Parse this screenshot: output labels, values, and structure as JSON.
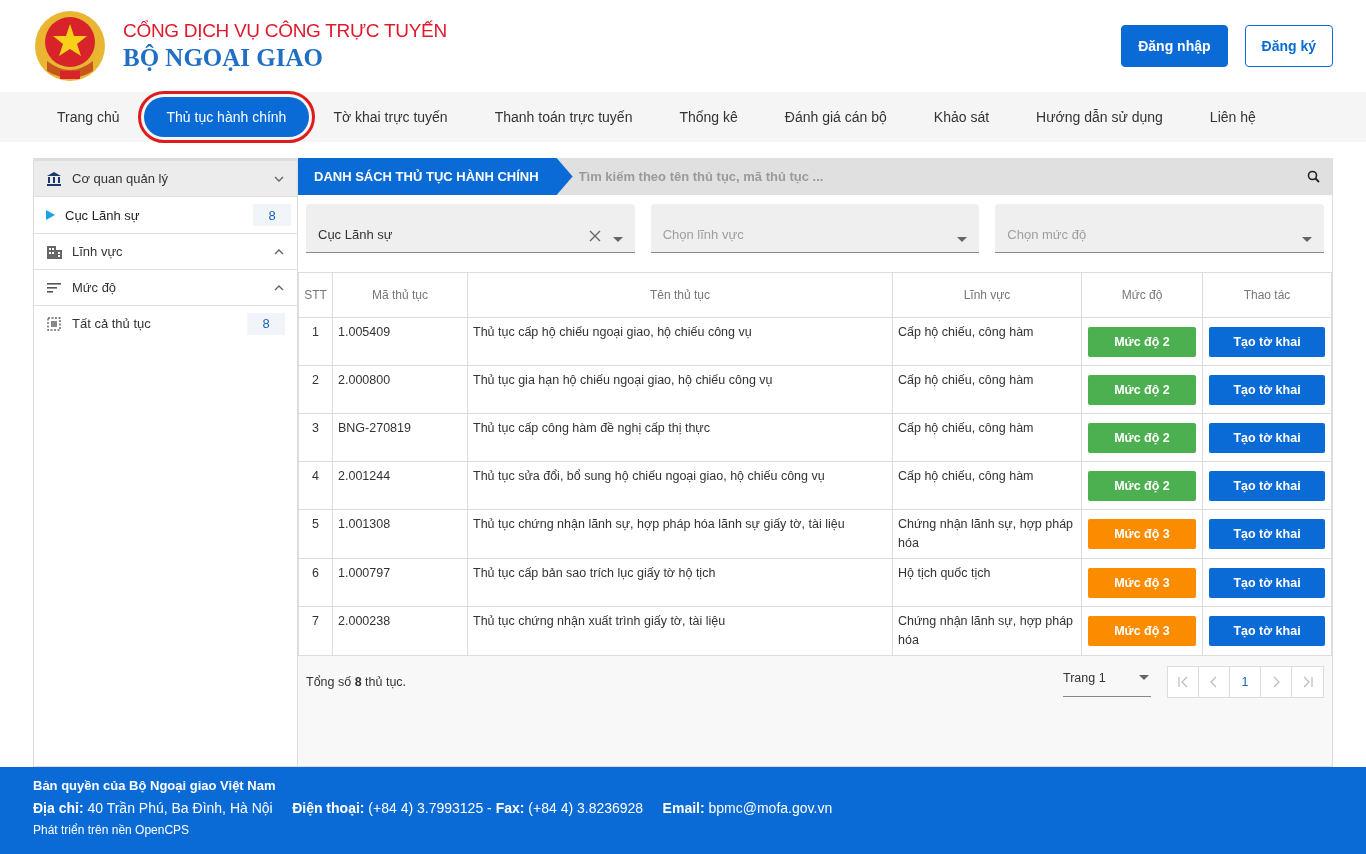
{
  "header": {
    "title_top": "CỔNG DỊCH VỤ CÔNG TRỰC TUYẾN",
    "title_main": "BỘ NGOẠI GIAO",
    "buttons": [
      {
        "label": "Đăng nhập",
        "kind": "primary"
      },
      {
        "label": "Đăng ký",
        "kind": "outline"
      }
    ]
  },
  "nav": {
    "tabs": [
      {
        "label": "Trang chủ",
        "selected": false
      },
      {
        "label": "Thủ tục hành chính",
        "selected": true
      },
      {
        "label": "Tờ khai trực tuyến",
        "selected": false
      },
      {
        "label": "Thanh toán trực tuyến",
        "selected": false
      },
      {
        "label": "Thống kê",
        "selected": false
      },
      {
        "label": "Đánh giá cán bộ",
        "selected": false
      },
      {
        "label": "Khảo sát",
        "selected": false
      },
      {
        "label": "Hướng dẫn sử dụng",
        "selected": false
      },
      {
        "label": "Liên hệ",
        "selected": false
      }
    ]
  },
  "sidebar": {
    "sections": [
      {
        "kind": "agency",
        "label": "Cơ quan quản lý",
        "expanded": true,
        "children": [
          {
            "label": "Cục Lãnh sự",
            "count": "8",
            "selected": true
          }
        ]
      },
      {
        "kind": "field",
        "label": "Lĩnh vực",
        "expanded": false
      },
      {
        "kind": "level",
        "label": "Mức độ",
        "expanded": false
      },
      {
        "kind": "all",
        "label": "Tất cả thủ tục",
        "count": "8"
      }
    ]
  },
  "list": {
    "title": "DANH SÁCH THỦ TỤC HÀNH CHÍNH",
    "search": {
      "placeholder": "Tìm kiếm theo tên thủ tục, mã thủ tục ..."
    },
    "filters": [
      {
        "value": "Cục Lãnh sự",
        "clearable": true
      },
      {
        "placeholder": "Chọn lĩnh vực",
        "clearable": false
      },
      {
        "placeholder": "Chọn mức độ",
        "clearable": false
      }
    ],
    "table": {
      "columns": [
        "STT",
        "Mã thủ tục",
        "Tên thủ tục",
        "Lĩnh vực",
        "Mức độ",
        "Thao tác"
      ],
      "rows": [
        {
          "stt": "1",
          "code": "1.005409",
          "name": "Thủ tục cấp hộ chiếu ngoại giao, hộ chiếu công vụ",
          "field": "Cấp hộ chiếu, công hàm",
          "level": {
            "label": "Mức độ 2",
            "color": "#4caf50"
          },
          "action": "Tạo tờ khai"
        },
        {
          "stt": "2",
          "code": "2.000800",
          "name": "Thủ tục gia hạn hộ chiếu ngoại giao, hộ chiếu công vụ",
          "field": "Cấp hộ chiếu, công hàm",
          "level": {
            "label": "Mức độ 2",
            "color": "#4caf50"
          },
          "action": "Tạo tờ khai"
        },
        {
          "stt": "3",
          "code": "BNG-270819",
          "name": "Thủ tục cấp công hàm đề nghị cấp thị thực",
          "field": "Cấp hộ chiếu, công hàm",
          "level": {
            "label": "Mức độ 2",
            "color": "#4caf50"
          },
          "action": "Tạo tờ khai"
        },
        {
          "stt": "4",
          "code": "2.001244",
          "name": "Thủ tục sửa đổi, bổ sung hộ chiếu ngoại giao, hộ chiếu công vụ",
          "field": "Cấp hộ chiếu, công hàm",
          "level": {
            "label": "Mức độ 2",
            "color": "#4caf50"
          },
          "action": "Tạo tờ khai"
        },
        {
          "stt": "5",
          "code": "1.001308",
          "name": "Thủ tục chứng nhận lãnh sự, hợp pháp hóa lãnh sự giấy tờ, tài liệu",
          "field": "Chứng nhận lãnh sự, hợp pháp hóa",
          "level": {
            "label": "Mức độ 3",
            "color": "#fb8c00"
          },
          "action": "Tạo tờ khai"
        },
        {
          "stt": "6",
          "code": "1.000797",
          "name": "Thủ tục cấp bản sao trích lục giấy tờ hộ tịch",
          "field": "Hộ tịch quốc tịch",
          "level": {
            "label": "Mức độ 3",
            "color": "#fb8c00"
          },
          "action": "Tạo tờ khai"
        },
        {
          "stt": "7",
          "code": "2.000238",
          "name": "Thủ tục chứng nhận xuất trình giấy tờ, tài liệu",
          "field": "Chứng nhận lãnh sự, hợp pháp hóa",
          "level": {
            "label": "Mức độ 3",
            "color": "#fb8c00"
          },
          "action": "Tạo tờ khai"
        }
      ]
    },
    "total": "Tổng số **8** thủ tục.",
    "page_select": "Trang 1",
    "current_page": "1"
  },
  "footer": {
    "copyright": "Bản quyền của Bộ Ngoại giao Việt Nam",
    "contact": "**Địa chỉ:** 40 Trần Phú, Ba Đình, Hà Nội     **Điện thoại:** (+84 4) 3.7993125 - **Fax:** (+84 4) 3.8236928     **Email:** bpmc@mofa.gov.vn",
    "platform": "Phát triển trên nền OpenCPS"
  }
}
